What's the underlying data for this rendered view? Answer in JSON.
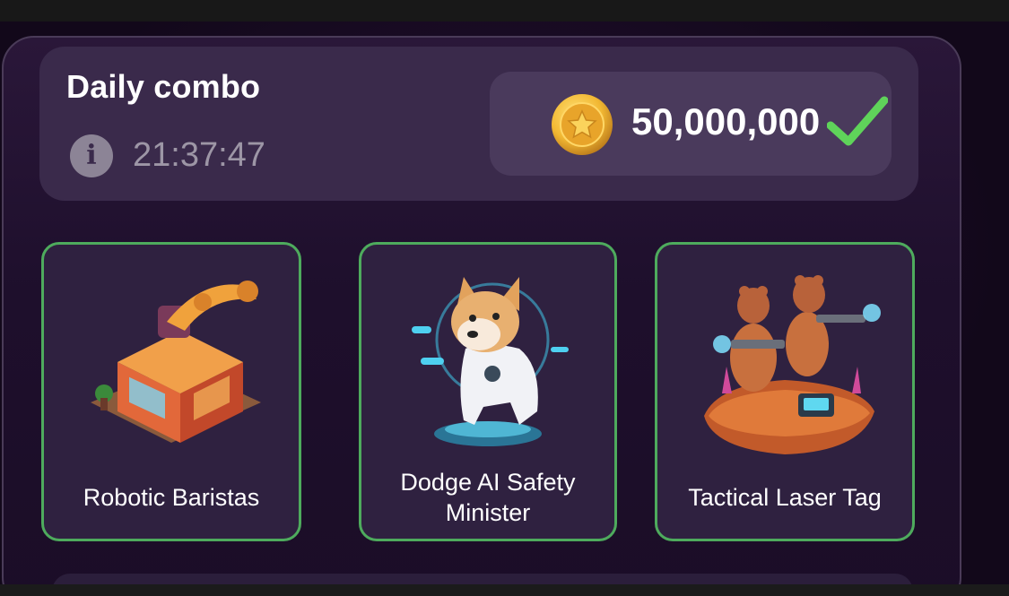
{
  "combo": {
    "title": "Daily combo",
    "timer": "21:37:47",
    "info_icon": "info-icon",
    "reward": "50,000,000",
    "reward_icon": "coin-icon",
    "status_icon": "checkmark-icon",
    "colors": {
      "accent_green": "#4eab5d",
      "coin_gold": "#f2b833",
      "check_green": "#5fd35a"
    }
  },
  "cards": [
    {
      "label": "Robotic Baristas",
      "image": "coffee-shop-robot-illustration"
    },
    {
      "label": "Dodge AI Safety Minister",
      "image": "shiba-dog-hologram-illustration"
    },
    {
      "label": "Tactical Laser Tag",
      "image": "capybara-laser-tag-illustration"
    }
  ]
}
